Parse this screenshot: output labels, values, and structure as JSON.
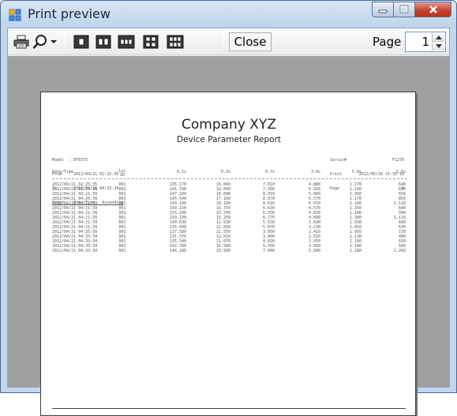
{
  "window": {
    "title": "Print preview"
  },
  "toolbar": {
    "print_icon": "printer-icon",
    "zoom_icon": "magnifier-icon",
    "zoom_dropdown_icon": "chevron-down-icon",
    "layout_icons": [
      "one-page-icon",
      "two-pages-icon",
      "three-pages-icon",
      "four-pages-icon",
      "six-pages-icon"
    ],
    "close_label": "Close",
    "page_label": "Page",
    "page_value": "1"
  },
  "report": {
    "company": "Company XYZ",
    "subtitle": "Device Parameter Report",
    "meta_left": [
      "Model  : DT6375",
      "From   : 2012/04/21 02:25:35",
      "To     : 2012/04/21 04:33:34",
      "Order  : Date/Time - Ascending"
    ],
    "meta_right_labels": [
      "Serial#",
      "Print",
      "Page"
    ],
    "meta_right_values": [
      "F1279",
      "2012/05/18 15:39:18",
      "1"
    ],
    "columns": [
      "Date/Time",
      "Loc ID",
      "0.1s",
      "0.3s",
      "0.7s",
      "3.0s",
      "5.0s",
      "5.0s"
    ],
    "rows": [
      [
        "2012/04/21 02:25:35",
        "001",
        "135.170",
        "16.060",
        "7.010",
        "4.880",
        "1.170",
        "640"
      ],
      [
        "2012/04/21 03:21:38",
        "001",
        "141.330",
        "16.890",
        "7.560",
        "5.010",
        "1.190",
        "650"
      ],
      [
        "2012/04/21 03:21:39",
        "001",
        "147.100",
        "16.090",
        "8.010",
        "5.460",
        "1.350",
        "650"
      ],
      [
        "2012/04/21 04:20:39",
        "001",
        "145.540",
        "17.160",
        "8.070",
        "5.570",
        "1.170",
        "850"
      ],
      [
        "2012/04/21 04:21:39",
        "001",
        "149.190",
        "18.160",
        "8.010",
        "6.550",
        "1.180",
        "1.110"
      ],
      [
        "2012/04/21 04:21:39",
        "001",
        "150.150",
        "16.750",
        "6.630",
        "4.570",
        "1.350",
        "640"
      ],
      [
        "2012/04/21 04:21:39",
        "001",
        "155.100",
        "15.760",
        "6.550",
        "4.650",
        "1.180",
        "500"
      ],
      [
        "2012/04/21 04:21:39",
        "001",
        "150.190",
        "15.250",
        "6.770",
        "4.890",
        "1.380",
        "1.110"
      ],
      [
        "2012/04/21 04:21:39",
        "001",
        "140.630",
        "12.930",
        "5.530",
        "3.690",
        "1.030",
        "680"
      ],
      [
        "2012/04/21 04:21:39",
        "001",
        "135.690",
        "12.810",
        "5.070",
        "3.230",
        "1.010",
        "630"
      ],
      [
        "2012/04/21 04:25:39",
        "001",
        "137.580",
        "11.550",
        "3.950",
        "2.410",
        "1.050",
        "720"
      ],
      [
        "2012/04/21 04:33:34",
        "001",
        "131.370",
        "12.810",
        "3.840",
        "2.510",
        "1.130",
        "490"
      ],
      [
        "2012/04/21 04:33:34",
        "001",
        "135.540",
        "11.070",
        "4.020",
        "2.950",
        "1.100",
        "650"
      ],
      [
        "2012/04/21 04:33:34",
        "001",
        "142.780",
        "16.580",
        "5.760",
        "3.890",
        "1.180",
        "509"
      ],
      [
        "2012/04/21 04:33:34",
        "001",
        "146.180",
        "15.500",
        "7.060",
        "5.090",
        "1.180",
        "1.260"
      ]
    ]
  },
  "colors": {
    "window_frame": "#c3d6ec",
    "close_red": "#c5442f",
    "viewport_gray": "#a0a0a0"
  }
}
